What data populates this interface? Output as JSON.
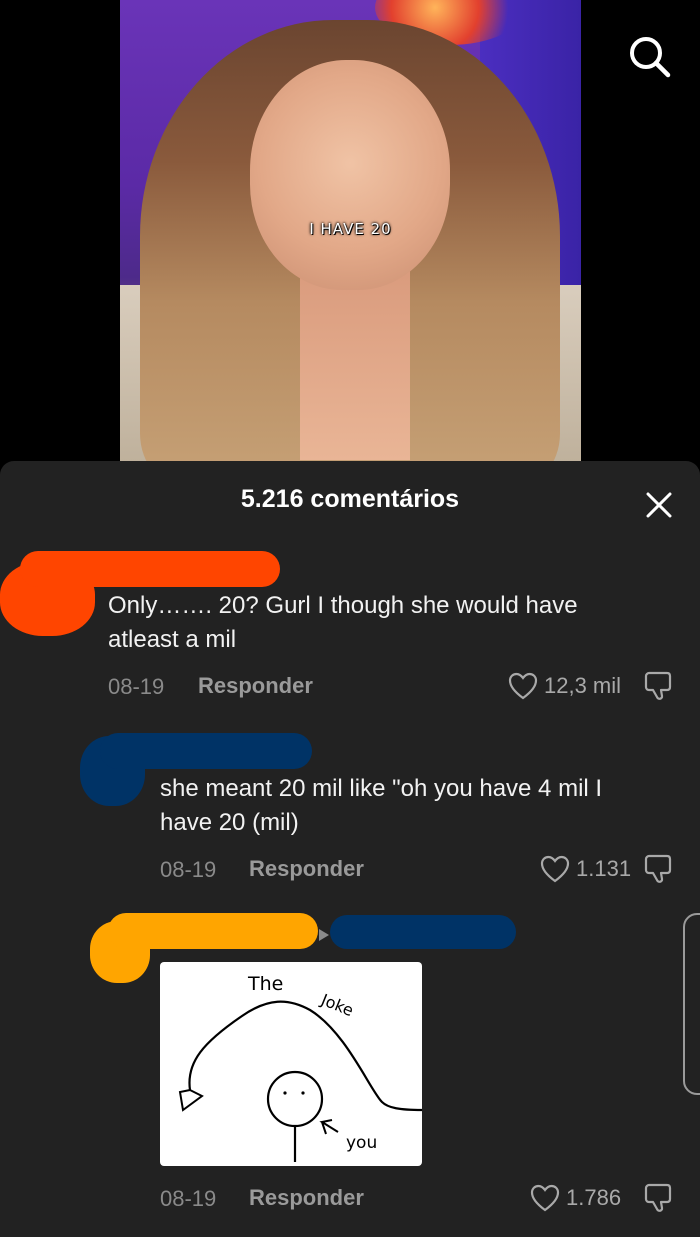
{
  "video": {
    "caption": "I HAVE 20",
    "search_icon": "search-icon"
  },
  "comments_sheet": {
    "title": "5.216 comentários",
    "close_icon": "close-icon",
    "comments": [
      {
        "text_line1": "Only……. 20? Gurl I though she would have",
        "text_line2": "atleast a mil",
        "date": "08-19",
        "reply_label": "Responder",
        "likes": "12,3 mil",
        "redaction_color": "#ff4500"
      },
      {
        "text_line1": "she meant 20 mil like \"oh you have 4 mil I",
        "text_line2": "have 20 (mil)",
        "date": "08-19",
        "reply_label": "Responder",
        "likes": "1.131",
        "redaction_color": "#003366"
      },
      {
        "image": {
          "title": "The",
          "title_curve": "Joke",
          "person_label": "you"
        },
        "date": "08-19",
        "reply_label": "Responder",
        "likes": "1.786",
        "redaction_color": "#ffa500",
        "redaction_color_2": "#003366"
      }
    ]
  },
  "colors": {
    "sheet_bg": "#222222",
    "text_primary": "#f2f2f2",
    "text_muted": "#8a8a8a"
  }
}
